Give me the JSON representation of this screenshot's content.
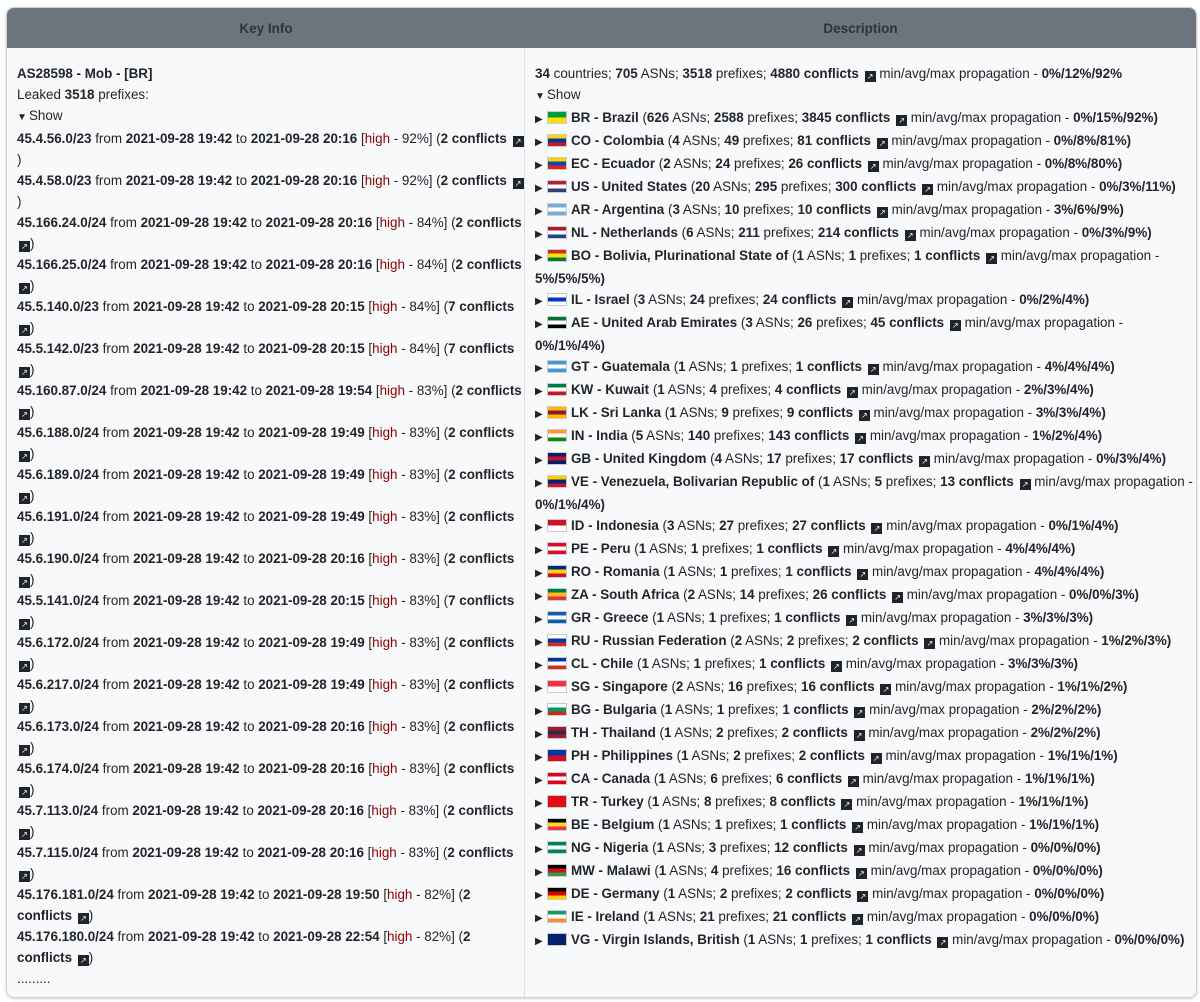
{
  "headers": {
    "key": "Key Info",
    "desc": "Description"
  },
  "key": {
    "asn_title": "AS28598 - Mob - [BR]",
    "leaked_label": "Leaked",
    "leaked_count": "3518",
    "leaked_suffix": "prefixes:",
    "show_label": "Show",
    "prefixes": [
      {
        "p": "45.4.56.0/23",
        "start": "2021-09-28 19:42",
        "end": "2021-09-28 20:16",
        "level": "high",
        "pct": "92%",
        "c": "2"
      },
      {
        "p": "45.4.58.0/23",
        "start": "2021-09-28 19:42",
        "end": "2021-09-28 20:16",
        "level": "high",
        "pct": "92%",
        "c": "2"
      },
      {
        "p": "45.166.24.0/24",
        "start": "2021-09-28 19:42",
        "end": "2021-09-28 20:16",
        "level": "high",
        "pct": "84%",
        "c": "2"
      },
      {
        "p": "45.166.25.0/24",
        "start": "2021-09-28 19:42",
        "end": "2021-09-28 20:16",
        "level": "high",
        "pct": "84%",
        "c": "2"
      },
      {
        "p": "45.5.140.0/23",
        "start": "2021-09-28 19:42",
        "end": "2021-09-28 20:15",
        "level": "high",
        "pct": "84%",
        "c": "7"
      },
      {
        "p": "45.5.142.0/23",
        "start": "2021-09-28 19:42",
        "end": "2021-09-28 20:15",
        "level": "high",
        "pct": "84%",
        "c": "7"
      },
      {
        "p": "45.160.87.0/24",
        "start": "2021-09-28 19:42",
        "end": "2021-09-28 19:54",
        "level": "high",
        "pct": "83%",
        "c": "2"
      },
      {
        "p": "45.6.188.0/24",
        "start": "2021-09-28 19:42",
        "end": "2021-09-28 19:49",
        "level": "high",
        "pct": "83%",
        "c": "2"
      },
      {
        "p": "45.6.189.0/24",
        "start": "2021-09-28 19:42",
        "end": "2021-09-28 19:49",
        "level": "high",
        "pct": "83%",
        "c": "2"
      },
      {
        "p": "45.6.191.0/24",
        "start": "2021-09-28 19:42",
        "end": "2021-09-28 19:49",
        "level": "high",
        "pct": "83%",
        "c": "2"
      },
      {
        "p": "45.6.190.0/24",
        "start": "2021-09-28 19:42",
        "end": "2021-09-28 20:16",
        "level": "high",
        "pct": "83%",
        "c": "2"
      },
      {
        "p": "45.5.141.0/24",
        "start": "2021-09-28 19:42",
        "end": "2021-09-28 20:15",
        "level": "high",
        "pct": "83%",
        "c": "7"
      },
      {
        "p": "45.6.172.0/24",
        "start": "2021-09-28 19:42",
        "end": "2021-09-28 19:49",
        "level": "high",
        "pct": "83%",
        "c": "2"
      },
      {
        "p": "45.6.217.0/24",
        "start": "2021-09-28 19:42",
        "end": "2021-09-28 19:49",
        "level": "high",
        "pct": "83%",
        "c": "2"
      },
      {
        "p": "45.6.173.0/24",
        "start": "2021-09-28 19:42",
        "end": "2021-09-28 20:16",
        "level": "high",
        "pct": "83%",
        "c": "2"
      },
      {
        "p": "45.6.174.0/24",
        "start": "2021-09-28 19:42",
        "end": "2021-09-28 20:16",
        "level": "high",
        "pct": "83%",
        "c": "2"
      },
      {
        "p": "45.7.113.0/24",
        "start": "2021-09-28 19:42",
        "end": "2021-09-28 20:16",
        "level": "high",
        "pct": "83%",
        "c": "2"
      },
      {
        "p": "45.7.115.0/24",
        "start": "2021-09-28 19:42",
        "end": "2021-09-28 20:16",
        "level": "high",
        "pct": "83%",
        "c": "2"
      },
      {
        "p": "45.176.181.0/24",
        "start": "2021-09-28 19:42",
        "end": "2021-09-28 19:50",
        "level": "high",
        "pct": "82%",
        "c": "2"
      },
      {
        "p": "45.176.180.0/24",
        "start": "2021-09-28 19:42",
        "end": "2021-09-28 22:54",
        "level": "high",
        "pct": "82%",
        "c": "2"
      }
    ],
    "ellipsis": "........."
  },
  "desc": {
    "summary": {
      "countries": "34",
      "asns": "705",
      "prefixes": "3518",
      "conflicts": "4880",
      "prop": "0%/12%/92%"
    },
    "show_label": "Show",
    "countries": [
      {
        "name": "BR - Brazil",
        "asns": "626",
        "prefixes": "2588",
        "conflicts": "3845",
        "prop": "0%/15%/92%",
        "flag": "#009c3b,#ffdf00"
      },
      {
        "name": "CO - Colombia",
        "asns": "4",
        "prefixes": "49",
        "conflicts": "81",
        "prop": "0%/8%/81%",
        "flag": "#fcd116,#003893,#ce1126"
      },
      {
        "name": "EC - Ecuador",
        "asns": "2",
        "prefixes": "24",
        "conflicts": "26",
        "prop": "0%/8%/80%",
        "flag": "#ffd100,#034ea2,#ed1c24"
      },
      {
        "name": "US - United States",
        "asns": "20",
        "prefixes": "295",
        "conflicts": "300",
        "prop": "0%/3%/11%",
        "flag": "#b22234,#ffffff,#3c3b6e"
      },
      {
        "name": "AR - Argentina",
        "asns": "3",
        "prefixes": "10",
        "conflicts": "10",
        "prop": "3%/6%/9%",
        "flag": "#74acdf,#ffffff,#74acdf"
      },
      {
        "name": "NL - Netherlands",
        "asns": "6",
        "prefixes": "211",
        "conflicts": "214",
        "prop": "0%/3%/9%",
        "flag": "#ae1c28,#ffffff,#21468b"
      },
      {
        "name": "BO - Bolivia, Plurinational State of",
        "asns": "1",
        "prefixes": "1",
        "conflicts": "1",
        "prop": "5%/5%/5%",
        "flag": "#d52b1e,#f9e300,#007934"
      },
      {
        "name": "IL - Israel",
        "asns": "3",
        "prefixes": "24",
        "conflicts": "24",
        "prop": "0%/2%/4%",
        "flag": "#ffffff,#0038b8,#ffffff"
      },
      {
        "name": "AE - United Arab Emirates",
        "asns": "3",
        "prefixes": "26",
        "conflicts": "45",
        "prop": "0%/1%/4%",
        "flag": "#00732f,#ffffff,#000000"
      },
      {
        "name": "GT - Guatemala",
        "asns": "1",
        "prefixes": "1",
        "conflicts": "1",
        "prop": "4%/4%/4%",
        "flag": "#4997d0,#ffffff,#4997d0"
      },
      {
        "name": "KW - Kuwait",
        "asns": "1",
        "prefixes": "4",
        "conflicts": "4",
        "prop": "2%/3%/4%",
        "flag": "#007a3d,#ffffff,#ce1126"
      },
      {
        "name": "LK - Sri Lanka",
        "asns": "1",
        "prefixes": "9",
        "conflicts": "9",
        "prop": "3%/3%/4%",
        "flag": "#ffb700,#8d153a,#ffb700"
      },
      {
        "name": "IN - India",
        "asns": "5",
        "prefixes": "140",
        "conflicts": "143",
        "prop": "1%/2%/4%",
        "flag": "#ff9933,#ffffff,#138808"
      },
      {
        "name": "GB - United Kingdom",
        "asns": "4",
        "prefixes": "17",
        "conflicts": "17",
        "prop": "0%/3%/4%",
        "flag": "#012169,#c8102e,#012169"
      },
      {
        "name": "VE - Venezuela, Bolivarian Republic of",
        "asns": "1",
        "prefixes": "5",
        "conflicts": "13",
        "prop": "0%/1%/4%",
        "flag": "#ffcc00,#00247d,#cf142b"
      },
      {
        "name": "ID - Indonesia",
        "asns": "3",
        "prefixes": "27",
        "conflicts": "27",
        "prop": "0%/1%/4%",
        "flag": "#ce1126,#ffffff"
      },
      {
        "name": "PE - Peru",
        "asns": "1",
        "prefixes": "1",
        "conflicts": "1",
        "prop": "4%/4%/4%",
        "flag": "#d91023,#ffffff,#d91023"
      },
      {
        "name": "RO - Romania",
        "asns": "1",
        "prefixes": "1",
        "conflicts": "1",
        "prop": "4%/4%/4%",
        "flag": "#002b7f,#fcd116,#ce1126"
      },
      {
        "name": "ZA - South Africa",
        "asns": "2",
        "prefixes": "14",
        "conflicts": "26",
        "prop": "0%/0%/3%",
        "flag": "#007749,#ffb81c,#de3831"
      },
      {
        "name": "GR - Greece",
        "asns": "1",
        "prefixes": "1",
        "conflicts": "1",
        "prop": "3%/3%/3%",
        "flag": "#0d5eaf,#ffffff,#0d5eaf"
      },
      {
        "name": "RU - Russian Federation",
        "asns": "2",
        "prefixes": "2",
        "conflicts": "2",
        "prop": "1%/2%/3%",
        "flag": "#ffffff,#0039a6,#d52b1e"
      },
      {
        "name": "CL - Chile",
        "asns": "1",
        "prefixes": "1",
        "conflicts": "1",
        "prop": "3%/3%/3%",
        "flag": "#0039a6,#ffffff,#d52b1e"
      },
      {
        "name": "SG - Singapore",
        "asns": "2",
        "prefixes": "16",
        "conflicts": "16",
        "prop": "1%/1%/2%",
        "flag": "#ef3340,#ffffff"
      },
      {
        "name": "BG - Bulgaria",
        "asns": "1",
        "prefixes": "1",
        "conflicts": "1",
        "prop": "2%/2%/2%",
        "flag": "#ffffff,#00966e,#d62612"
      },
      {
        "name": "TH - Thailand",
        "asns": "1",
        "prefixes": "2",
        "conflicts": "2",
        "prop": "2%/2%/2%",
        "flag": "#a51931,#2d2a4a,#a51931"
      },
      {
        "name": "PH - Philippines",
        "asns": "1",
        "prefixes": "2",
        "conflicts": "2",
        "prop": "1%/1%/1%",
        "flag": "#0038a8,#ce1126"
      },
      {
        "name": "CA - Canada",
        "asns": "1",
        "prefixes": "6",
        "conflicts": "6",
        "prop": "1%/1%/1%",
        "flag": "#d80621,#ffffff,#d80621"
      },
      {
        "name": "TR - Turkey",
        "asns": "1",
        "prefixes": "8",
        "conflicts": "8",
        "prop": "1%/1%/1%",
        "flag": "#e30a17,#e30a17"
      },
      {
        "name": "BE - Belgium",
        "asns": "1",
        "prefixes": "1",
        "conflicts": "1",
        "prop": "1%/1%/1%",
        "flag": "#000000,#fdda24,#ef3340"
      },
      {
        "name": "NG - Nigeria",
        "asns": "1",
        "prefixes": "3",
        "conflicts": "12",
        "prop": "0%/0%/0%",
        "flag": "#008751,#ffffff,#008751"
      },
      {
        "name": "MW - Malawi",
        "asns": "1",
        "prefixes": "4",
        "conflicts": "16",
        "prop": "0%/0%/0%",
        "flag": "#000000,#ce1126,#339e35"
      },
      {
        "name": "DE - Germany",
        "asns": "1",
        "prefixes": "2",
        "conflicts": "2",
        "prop": "0%/0%/0%",
        "flag": "#000000,#dd0000,#ffce00"
      },
      {
        "name": "IE - Ireland",
        "asns": "1",
        "prefixes": "21",
        "conflicts": "21",
        "prop": "0%/0%/0%",
        "flag": "#169b62,#ffffff,#ff883e"
      },
      {
        "name": "VG - Virgin Islands, British",
        "asns": "1",
        "prefixes": "1",
        "conflicts": "1",
        "prop": "0%/0%/0%",
        "flag": "#012169,#012169"
      }
    ]
  }
}
